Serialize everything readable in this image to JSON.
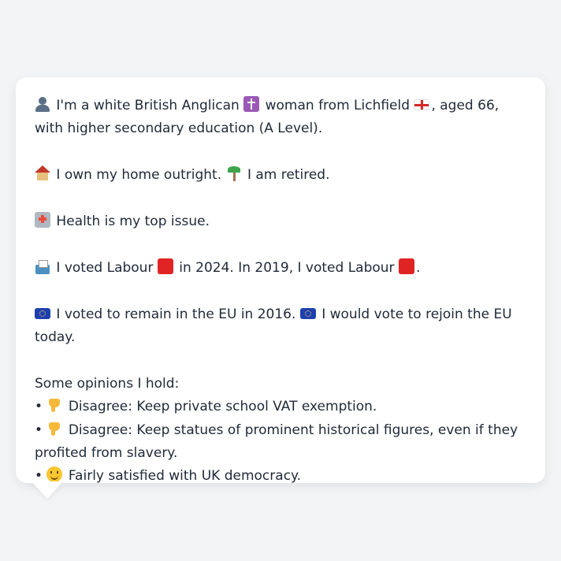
{
  "bio": {
    "line1_a": "I'm a white British Anglican",
    "line1_b": "woman from Lichfield",
    "line1_c": ", aged 66, with higher secondary education (A Level)."
  },
  "home": {
    "a": "I own my home outright.",
    "b": "I am retired."
  },
  "issue": {
    "text": "Health is my top issue."
  },
  "vote": {
    "a": "I voted Labour",
    "b": "in 2024. In 2019, I voted Labour",
    "c": "."
  },
  "eu": {
    "a": "I voted to remain in the EU in 2016.",
    "b": "I would vote to rejoin the EU today."
  },
  "opinions": {
    "heading": "Some opinions I hold:",
    "bullet": "•",
    "items": [
      {
        "text": "Disagree: Keep private school VAT exemption.",
        "icon": "thumbs-down-icon"
      },
      {
        "text": "Disagree: Keep statues of prominent historical figures, even if they profited from slavery.",
        "icon": "thumbs-down-icon"
      },
      {
        "text": "Fairly satisfied with UK democracy.",
        "icon": "slight-smile-icon"
      }
    ]
  },
  "colors": {
    "background": "#f3f4f6",
    "card": "#ffffff",
    "text": "#1f2937",
    "labour_red": "#e02424"
  }
}
